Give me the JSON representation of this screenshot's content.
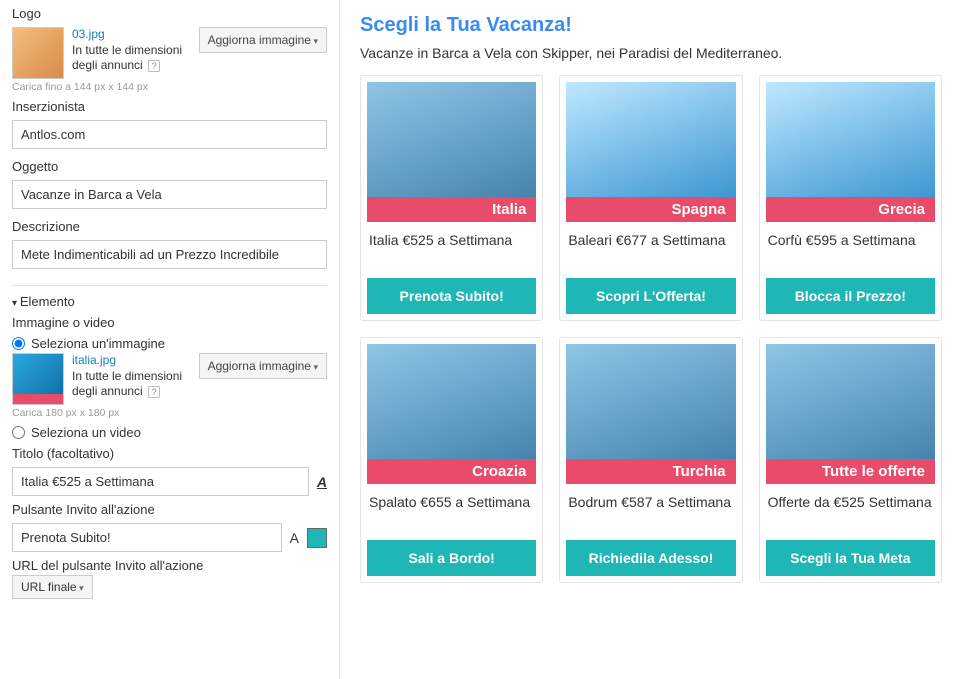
{
  "sidebar": {
    "logo_label": "Logo",
    "logo_file": "03.jpg",
    "logo_dims_text": "In tutte le dimensioni degli annunci",
    "update_image_btn": "Aggiorna immagine",
    "logo_hint": "Carica fino a 144 px x 144 px",
    "advertiser_label": "Inserzionista",
    "advertiser_value": "Antlos.com",
    "subject_label": "Oggetto",
    "subject_value": "Vacanze in Barca a Vela",
    "description_label": "Descrizione",
    "description_value": "Mete Indimenticabili ad un Prezzo Incredibile",
    "element_header": "Elemento",
    "image_or_video_label": "Immagine o video",
    "radio_select_image": "Seleziona un'immagine",
    "element_file": "italia.jpg",
    "element_dims_text": "In tutte le dimensioni degli annunci",
    "element_hint": "Carica 180 px x 180 px",
    "radio_select_video": "Seleziona un video",
    "title_label": "Titolo  (facoltativo)",
    "title_value": "Italia €525 a Settimana",
    "cta_label": "Pulsante Invito all'azione",
    "cta_value": "Prenota Subito!",
    "cta_url_label": "URL del pulsante Invito all'azione",
    "cta_url_select": "URL finale"
  },
  "preview": {
    "title": "Scegli la Tua Vacanza!",
    "subtitle": "Vacanze in Barca a Vela con Skipper, nei Paradisi del Mediterraneo.",
    "cards": [
      {
        "badge": "Italia",
        "text": "Italia €525 a Settimana",
        "btn": "Prenota Subito!"
      },
      {
        "badge": "Spagna",
        "text": "Baleari €677 a Settimana",
        "btn": "Scopri L'Offerta!"
      },
      {
        "badge": "Grecia",
        "text": "Corfù €595 a Settimana",
        "btn": "Blocca il Prezzo!"
      },
      {
        "badge": "Croazia",
        "text": "Spalato €655 a Settimana",
        "btn": "Sali a Bordo!"
      },
      {
        "badge": "Turchia",
        "text": "Bodrum €587 a Settimana",
        "btn": "Richiedila Adesso!"
      },
      {
        "badge": "Tutte le offerte",
        "text": "Offerte da €525 Settimana",
        "btn": "Scegli la Tua Meta"
      }
    ]
  }
}
